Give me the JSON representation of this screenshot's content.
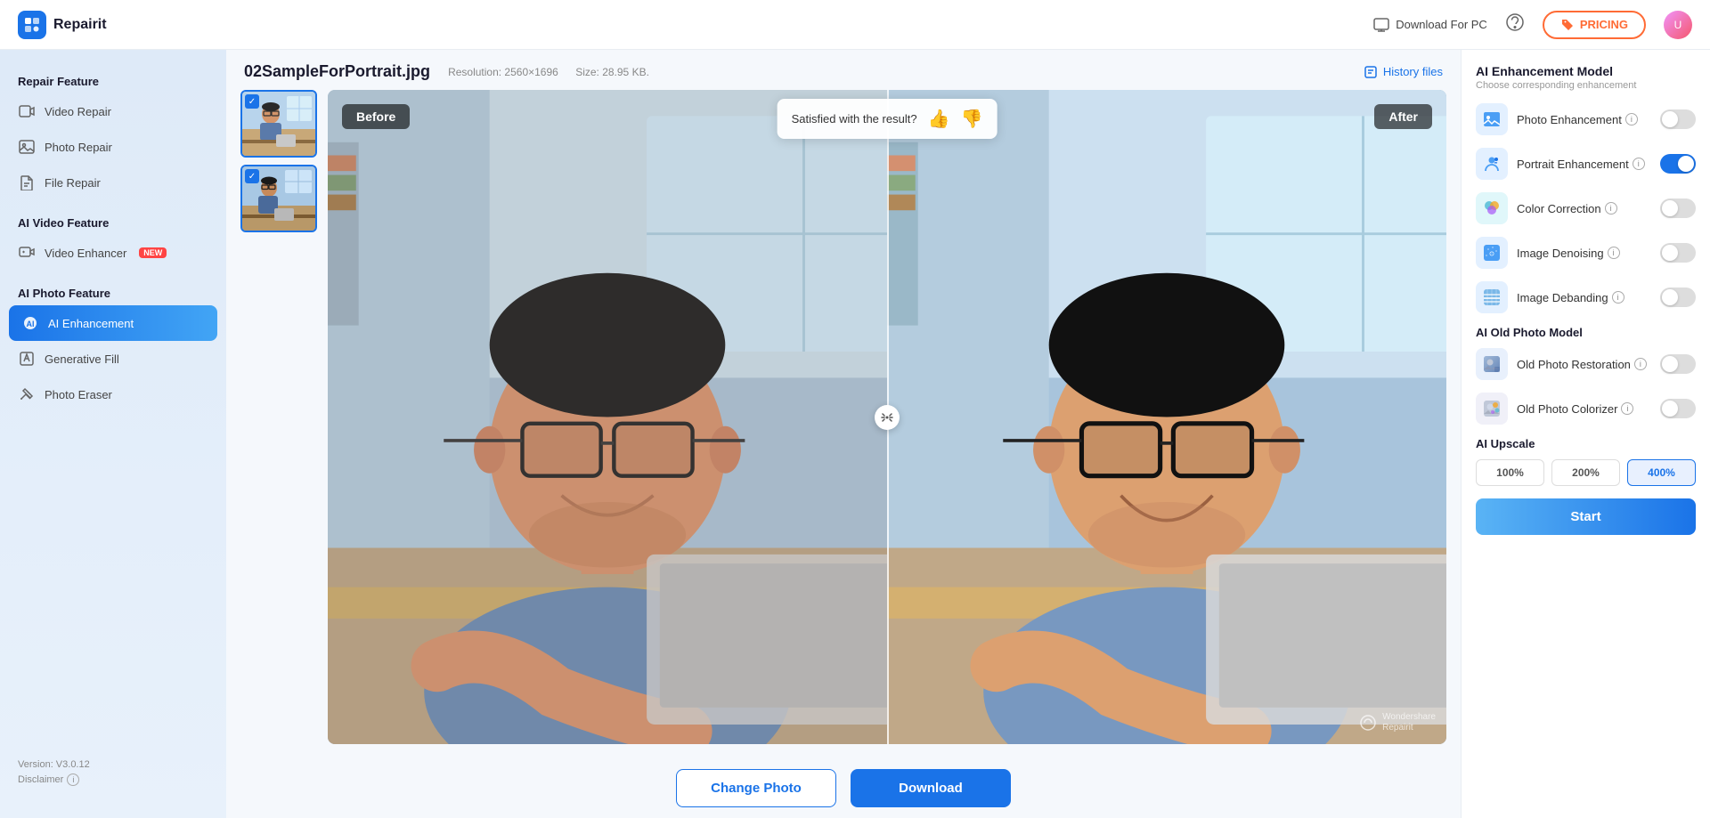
{
  "header": {
    "logo_text": "Repairit",
    "download_pc_label": "Download For PC",
    "pricing_label": "PRICING",
    "user_initial": "U"
  },
  "sidebar": {
    "repair_feature_title": "Repair Feature",
    "video_repair_label": "Video Repair",
    "photo_repair_label": "Photo Repair",
    "file_repair_label": "File Repair",
    "ai_video_feature_title": "AI Video Feature",
    "video_enhancer_label": "Video Enhancer",
    "new_badge": "NEW",
    "ai_photo_feature_title": "AI Photo Feature",
    "ai_enhancement_label": "AI Enhancement",
    "generative_fill_label": "Generative Fill",
    "photo_eraser_label": "Photo Eraser",
    "version": "Version: V3.0.12",
    "disclaimer": "Disclaimer"
  },
  "file_info": {
    "filename": "02SampleForPortrait.jpg",
    "resolution_label": "Resolution: 2560×1696",
    "size_label": "Size: 28.95 KB.",
    "history_files_label": "History files"
  },
  "preview": {
    "before_label": "Before",
    "after_label": "After",
    "satisfied_text": "Satisfied with the result?",
    "watermark_text": "Wondershare\nRepairit"
  },
  "actions": {
    "change_photo_label": "Change Photo",
    "download_label": "Download"
  },
  "right_panel": {
    "title": "AI Enhancement Model",
    "subtitle": "Choose corresponding enhancement",
    "enhancement_section_title": "AI Enhancement Model",
    "photo_enhancement_label": "Photo Enhancement",
    "portrait_enhancement_label": "Portrait Enhancement",
    "color_correction_label": "Color Correction",
    "image_denoising_label": "Image Denoising",
    "image_debanding_label": "Image Debanding",
    "old_photo_model_title": "AI Old Photo Model",
    "old_photo_restoration_label": "Old Photo Restoration",
    "old_photo_colorizer_label": "Old Photo Colorizer",
    "ai_upscale_title": "AI Upscale",
    "upscale_100": "100%",
    "upscale_200": "200%",
    "upscale_400": "400%",
    "start_label": "Start",
    "portrait_toggle_on": true,
    "photo_toggle_on": false,
    "color_toggle_on": false,
    "denoising_toggle_on": false,
    "debanding_toggle_on": false,
    "old_photo_restoration_on": false,
    "old_photo_colorizer_on": false,
    "active_upscale": "400%"
  }
}
